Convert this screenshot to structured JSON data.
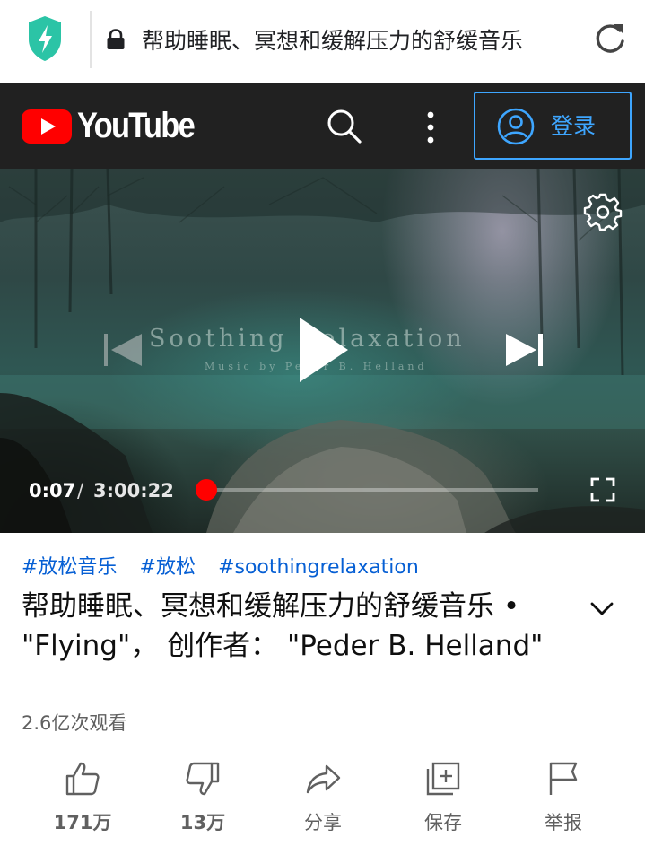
{
  "browser": {
    "url_text": "帮助睡眠、冥想和缓解压力的舒缓音乐",
    "security_icon": "shield-bolt-icon",
    "lock_icon": "lock-icon",
    "reload_icon": "reload-icon"
  },
  "header": {
    "logo_text": "YouTube",
    "signin_label": "登录",
    "colors": {
      "brand_red": "#ff0000",
      "header_bg": "#212121",
      "link_blue": "#3ea6ff"
    }
  },
  "player": {
    "video_overlay_title": "Soothing Relaxation",
    "video_overlay_subtitle": "Music by Peder B. Helland",
    "current_time": "0:07",
    "time_separator": "/",
    "duration": "3:00:22",
    "progress_percent": 0.06
  },
  "info": {
    "hashtags": [
      "#放松音乐",
      "#放松",
      "#soothingrelaxation"
    ],
    "title": "帮助睡眠、冥想和缓解压力的舒缓音乐 • \"Flying\"， 创作者： \"Peder B. Helland\"",
    "views": "2.6亿次观看"
  },
  "actions": {
    "like": "171万",
    "dislike": "13万",
    "share": "分享",
    "save": "保存",
    "report": "举报"
  }
}
